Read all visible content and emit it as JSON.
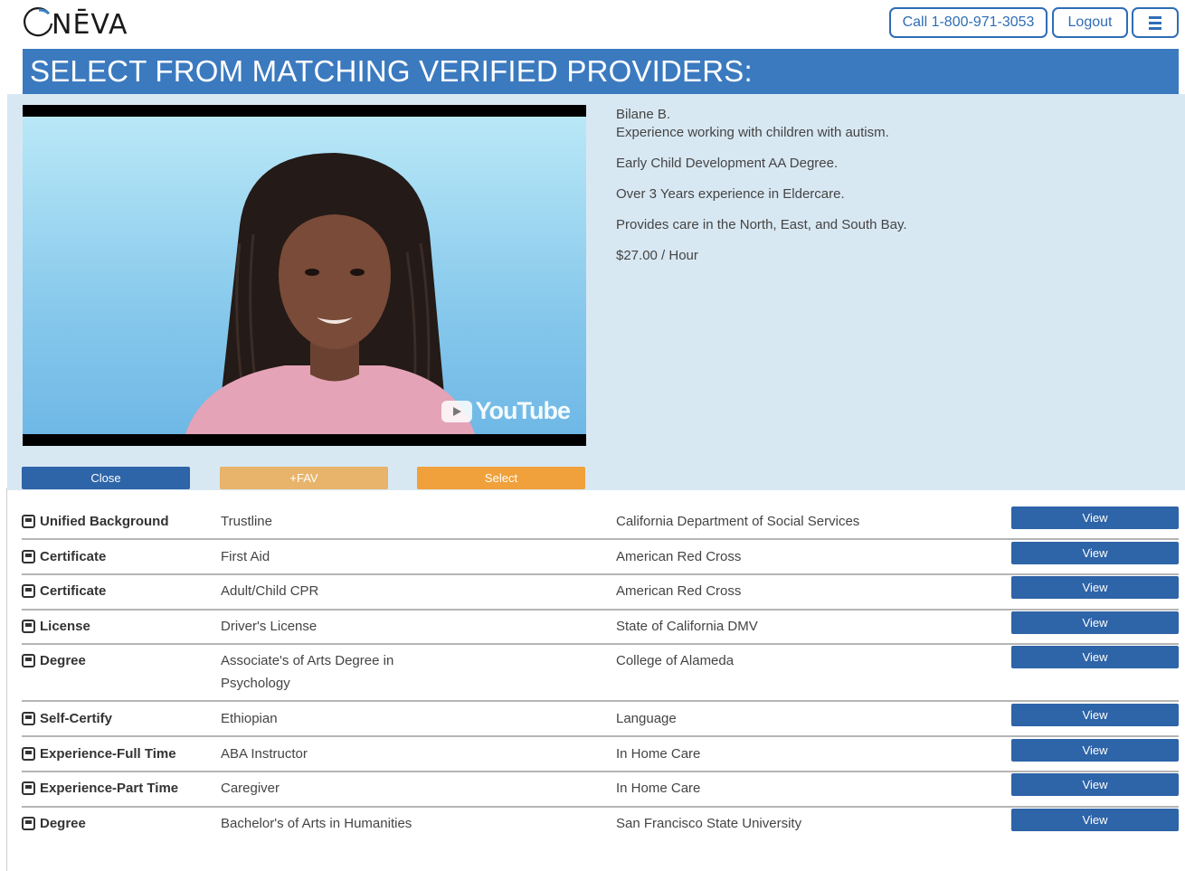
{
  "header": {
    "logo_text": "NĒVA",
    "call_label": "Call 1-800-971-3053",
    "logout_label": "Logout",
    "menu_icon": "hamburger-icon"
  },
  "banner": {
    "title": "SELECT FROM MATCHING VERIFIED PROVIDERS:"
  },
  "provider": {
    "name": "Bilane B.",
    "summary": "Experience working with children with autism.",
    "education": "Early Child Development AA Degree.",
    "experience": "Over 3 Years experience in Eldercare.",
    "area": "Provides care in the North, East, and South Bay.",
    "rate": "$27.00 / Hour",
    "video_brand": "YouTube"
  },
  "actions": {
    "close": "Close",
    "fav": "+FAV",
    "select": "Select"
  },
  "credentials": [
    {
      "type": "Unified Background",
      "desc": "Trustline",
      "org": "California Department of Social Services",
      "view": "View"
    },
    {
      "type": "Certificate",
      "desc": "First Aid",
      "org": "American Red Cross",
      "view": "View"
    },
    {
      "type": "Certificate",
      "desc": "Adult/Child CPR",
      "org": "American Red Cross",
      "view": "View"
    },
    {
      "type": "License",
      "desc": "Driver's License",
      "org": "State of California DMV",
      "view": "View"
    },
    {
      "type": "Degree",
      "desc": "Associate's of Arts Degree in Psychology",
      "org": "College of Alameda",
      "view": "View"
    },
    {
      "type": "Self-Certify",
      "desc": "Ethiopian",
      "org": "Language",
      "view": "View"
    },
    {
      "type": "Experience-Full Time",
      "desc": "ABA Instructor",
      "org": "In Home Care",
      "view": "View"
    },
    {
      "type": "Experience-Part Time",
      "desc": "Caregiver",
      "org": "In Home Care",
      "view": "View"
    },
    {
      "type": "Degree",
      "desc": "Bachelor's of Arts in Humanities",
      "org": "San Francisco State University",
      "view": "View"
    }
  ],
  "colors": {
    "primary": "#2e64a8",
    "banner": "#3b7abf",
    "panel": "#d8e8f3",
    "fav": "#e8b36b",
    "select": "#f0a13b"
  }
}
